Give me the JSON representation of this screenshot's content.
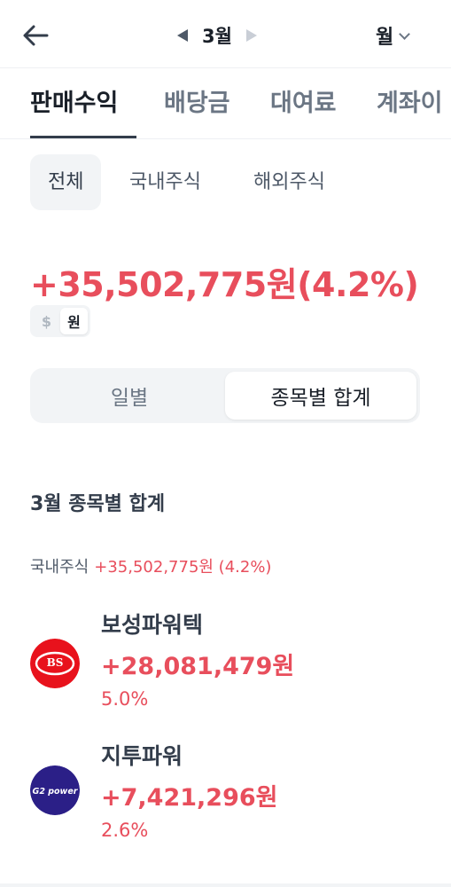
{
  "header": {
    "month": "3월",
    "period": "월"
  },
  "tabs": [
    {
      "label": "판매수익"
    },
    {
      "label": "배당금"
    },
    {
      "label": "대여료"
    },
    {
      "label": "계좌이"
    }
  ],
  "subtabs": [
    {
      "label": "전체"
    },
    {
      "label": "국내주식"
    },
    {
      "label": "해외주식"
    }
  ],
  "total": "+35,502,775원(4.2%)",
  "currency": {
    "dollar": "$",
    "won": "원"
  },
  "view_toggle": {
    "daily": "일별",
    "by_stock": "종목별 합계"
  },
  "section_title": "3월 종목별 합계",
  "summary": {
    "label": "국내주식",
    "value": "+35,502,775원 (4.2%)"
  },
  "stocks": [
    {
      "name": "보성파워텍",
      "amount": "+28,081,479원",
      "pct": "5.0%",
      "logo_text": "BS",
      "logo_color": "#e8121c"
    },
    {
      "name": "지투파워",
      "amount": "+7,421,296원",
      "pct": "2.6%",
      "logo_text": "G2 power",
      "logo_color": "#2b1f87"
    }
  ],
  "colors": {
    "accent_red": "#e84e5c",
    "text_primary": "#191f28",
    "text_secondary": "#6b7684"
  },
  "icons": {
    "back": "arrow-left-icon",
    "prev": "triangle-left-icon",
    "next": "triangle-right-icon",
    "dropdown": "chevron-down-icon"
  }
}
